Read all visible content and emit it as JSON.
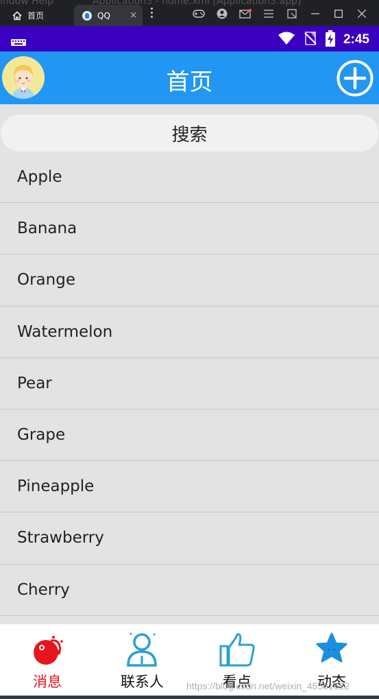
{
  "emulator": {
    "background_text_left": "indow  Help",
    "background_text_right": "Application3 - home.xml [Application3.app]",
    "tabs": [
      {
        "label": "首页"
      },
      {
        "label": "QQ",
        "close": "×"
      }
    ]
  },
  "status_bar": {
    "time": "2:45"
  },
  "app_bar": {
    "title": "首页"
  },
  "search": {
    "label": "搜索"
  },
  "list": [
    "Apple",
    "Banana",
    "Orange",
    "Watermelon",
    "Pear",
    "Grape",
    "Pineapple",
    "Strawberry",
    "Cherry"
  ],
  "bottom_nav": [
    {
      "label": "消息",
      "icon": "message-icon",
      "active": true
    },
    {
      "label": "联系人",
      "icon": "contacts-icon",
      "active": false
    },
    {
      "label": "看点",
      "icon": "thumbs-up-icon",
      "active": false
    },
    {
      "label": "动态",
      "icon": "star-icon",
      "active": false
    }
  ],
  "watermark": "https://blog.csdn.net/weixin_45561022",
  "colors": {
    "status_bar": "#3a00c0",
    "app_bar": "#2196f3",
    "list_bg": "#e4e3e3",
    "active_tab": "#e8141d"
  }
}
